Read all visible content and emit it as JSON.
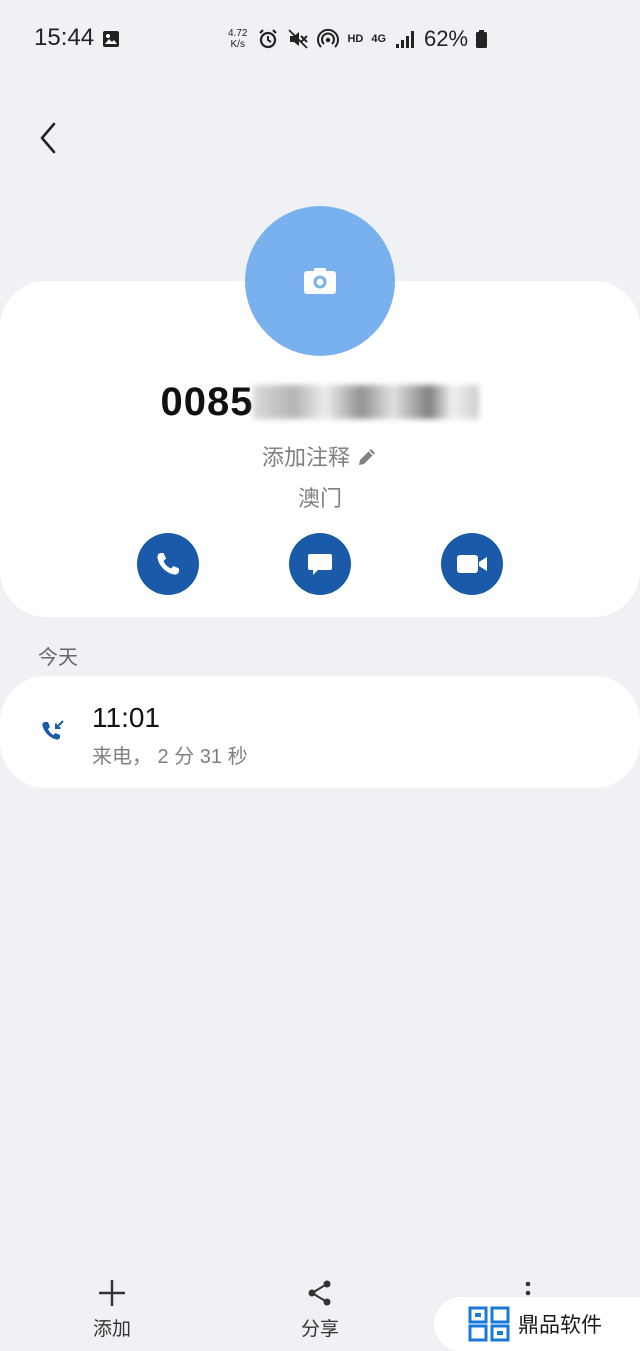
{
  "status_bar": {
    "time": "15:44",
    "net_speed_value": "4.72",
    "net_speed_unit": "K/s",
    "hd_label": "HD",
    "network_label": "4G",
    "battery_percent": "62%"
  },
  "contact": {
    "number_visible": "0085",
    "add_note_label": "添加注释",
    "region": "澳门"
  },
  "actions": [
    {
      "name": "call",
      "icon": "phone-icon"
    },
    {
      "name": "message",
      "icon": "message-icon"
    },
    {
      "name": "video",
      "icon": "video-icon"
    }
  ],
  "history": {
    "section_label": "今天",
    "entries": [
      {
        "time": "11:01",
        "detail": "来电， 2 分 31 秒",
        "icon": "incoming-call-icon"
      }
    ]
  },
  "bottom_bar": {
    "add_label": "添加",
    "share_label": "分享"
  },
  "watermark": {
    "text": "鼎品软件"
  },
  "colors": {
    "background": "#f0f1f5",
    "card": "#ffffff",
    "avatar": "#78b1ee",
    "action_button": "#1a5aa9",
    "secondary_text": "#808080"
  }
}
